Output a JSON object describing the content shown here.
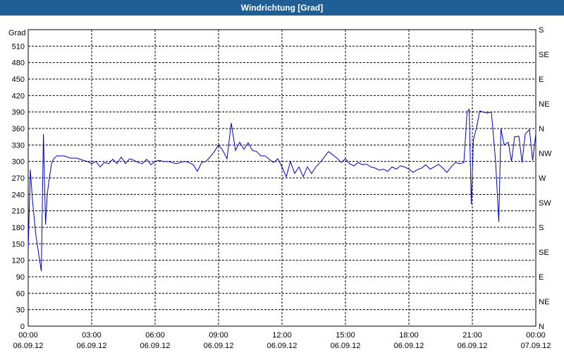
{
  "title": "Windrichtung [Grad]",
  "colors": {
    "title_bg": "#1f5f96",
    "series": "#0000c8"
  },
  "chart_data": {
    "type": "line",
    "title": "Windrichtung [Grad]",
    "ylabel": "Grad",
    "ylim": [
      0,
      540
    ],
    "yticks": [
      0,
      30,
      60,
      90,
      120,
      150,
      180,
      210,
      240,
      270,
      300,
      330,
      360,
      390,
      420,
      450,
      480,
      510
    ],
    "right_ticks": [
      {
        "value": 0,
        "label": "N"
      },
      {
        "value": 45,
        "label": "NE"
      },
      {
        "value": 90,
        "label": "E"
      },
      {
        "value": 135,
        "label": "SE"
      },
      {
        "value": 180,
        "label": "S"
      },
      {
        "value": 225,
        "label": "SW"
      },
      {
        "value": 270,
        "label": "W"
      },
      {
        "value": 315,
        "label": "NW"
      },
      {
        "value": 360,
        "label": "N"
      },
      {
        "value": 405,
        "label": "NE"
      },
      {
        "value": 450,
        "label": "E"
      },
      {
        "value": 495,
        "label": "SE"
      },
      {
        "value": 540,
        "label": "S"
      }
    ],
    "xlim": [
      "06.09.12 00:00",
      "07.09.12 00:00"
    ],
    "xticks": [
      {
        "value": 0,
        "time": "00:00",
        "date": "06.09.12"
      },
      {
        "value": 3,
        "time": "03:00",
        "date": "06.09.12"
      },
      {
        "value": 6,
        "time": "06:00",
        "date": "06.09.12"
      },
      {
        "value": 9,
        "time": "09:00",
        "date": "06.09.12"
      },
      {
        "value": 12,
        "time": "12:00",
        "date": "06.09.12"
      },
      {
        "value": 15,
        "time": "15:00",
        "date": "06.09.12"
      },
      {
        "value": 18,
        "time": "18:00",
        "date": "06.09.12"
      },
      {
        "value": 21,
        "time": "21:00",
        "date": "06.09.12"
      },
      {
        "value": 24,
        "time": "00:00",
        "date": "07.09.12"
      }
    ],
    "grid": true,
    "series": [
      {
        "x": [
          0,
          0.1,
          0.2,
          0.35,
          0.5,
          0.62,
          0.72,
          0.82,
          0.9,
          1.0,
          1.1,
          1.2,
          1.35,
          1.5,
          1.7,
          2.0,
          2.3,
          2.6,
          2.8,
          3.0,
          3.2,
          3.4,
          3.6,
          3.8,
          4.0,
          4.2,
          4.4,
          4.6,
          4.8,
          5.0,
          5.2,
          5.4,
          5.6,
          5.8,
          6.0,
          6.2,
          6.4,
          6.6,
          6.8,
          7.0,
          7.2,
          7.4,
          7.6,
          7.8,
          8.0,
          8.2,
          8.4,
          8.6,
          8.8,
          9.0,
          9.2,
          9.4,
          9.6,
          9.8,
          10.0,
          10.2,
          10.4,
          10.6,
          10.8,
          11.0,
          11.2,
          11.4,
          11.6,
          11.8,
          12.0,
          12.2,
          12.4,
          12.6,
          12.8,
          13.0,
          13.2,
          13.4,
          13.6,
          13.8,
          14.0,
          14.2,
          14.4,
          14.6,
          14.8,
          15.0,
          15.2,
          15.4,
          15.6,
          15.8,
          16.0,
          16.2,
          16.4,
          16.6,
          16.8,
          17.0,
          17.2,
          17.4,
          17.6,
          17.8,
          18.0,
          18.2,
          18.4,
          18.6,
          18.8,
          19.0,
          19.2,
          19.4,
          19.6,
          19.8,
          20.0,
          20.2,
          20.4,
          20.6,
          20.75,
          20.85,
          20.95,
          21.05,
          21.2,
          21.35,
          21.5,
          21.7,
          21.9,
          22.1,
          22.25,
          22.35,
          22.5,
          22.7,
          22.85,
          23.0,
          23.2,
          23.35,
          23.5,
          23.7,
          23.85,
          24.0
        ],
        "y": [
          140,
          285,
          230,
          170,
          130,
          100,
          350,
          185,
          240,
          270,
          295,
          305,
          310,
          310,
          310,
          306,
          306,
          302,
          300,
          296,
          300,
          290,
          298,
          296,
          304,
          296,
          308,
          296,
          305,
          302,
          298,
          296,
          304,
          294,
          300,
          302,
          300,
          300,
          298,
          296,
          298,
          300,
          298,
          294,
          282,
          298,
          300,
          308,
          318,
          330,
          320,
          305,
          370,
          320,
          335,
          322,
          334,
          320,
          318,
          310,
          310,
          304,
          298,
          305,
          290,
          272,
          300,
          278,
          290,
          272,
          290,
          278,
          290,
          298,
          308,
          318,
          312,
          306,
          298,
          305,
          296,
          292,
          298,
          294,
          295,
          290,
          288,
          284,
          286,
          282,
          290,
          286,
          292,
          290,
          286,
          280,
          285,
          288,
          294,
          286,
          290,
          295,
          288,
          280,
          290,
          298,
          296,
          298,
          390,
          395,
          222,
          340,
          362,
          392,
          390,
          388,
          390,
          300,
          190,
          360,
          330,
          335,
          300,
          345,
          346,
          298,
          350,
          358,
          302,
          350
        ],
        "color": "#0000c8"
      }
    ]
  }
}
